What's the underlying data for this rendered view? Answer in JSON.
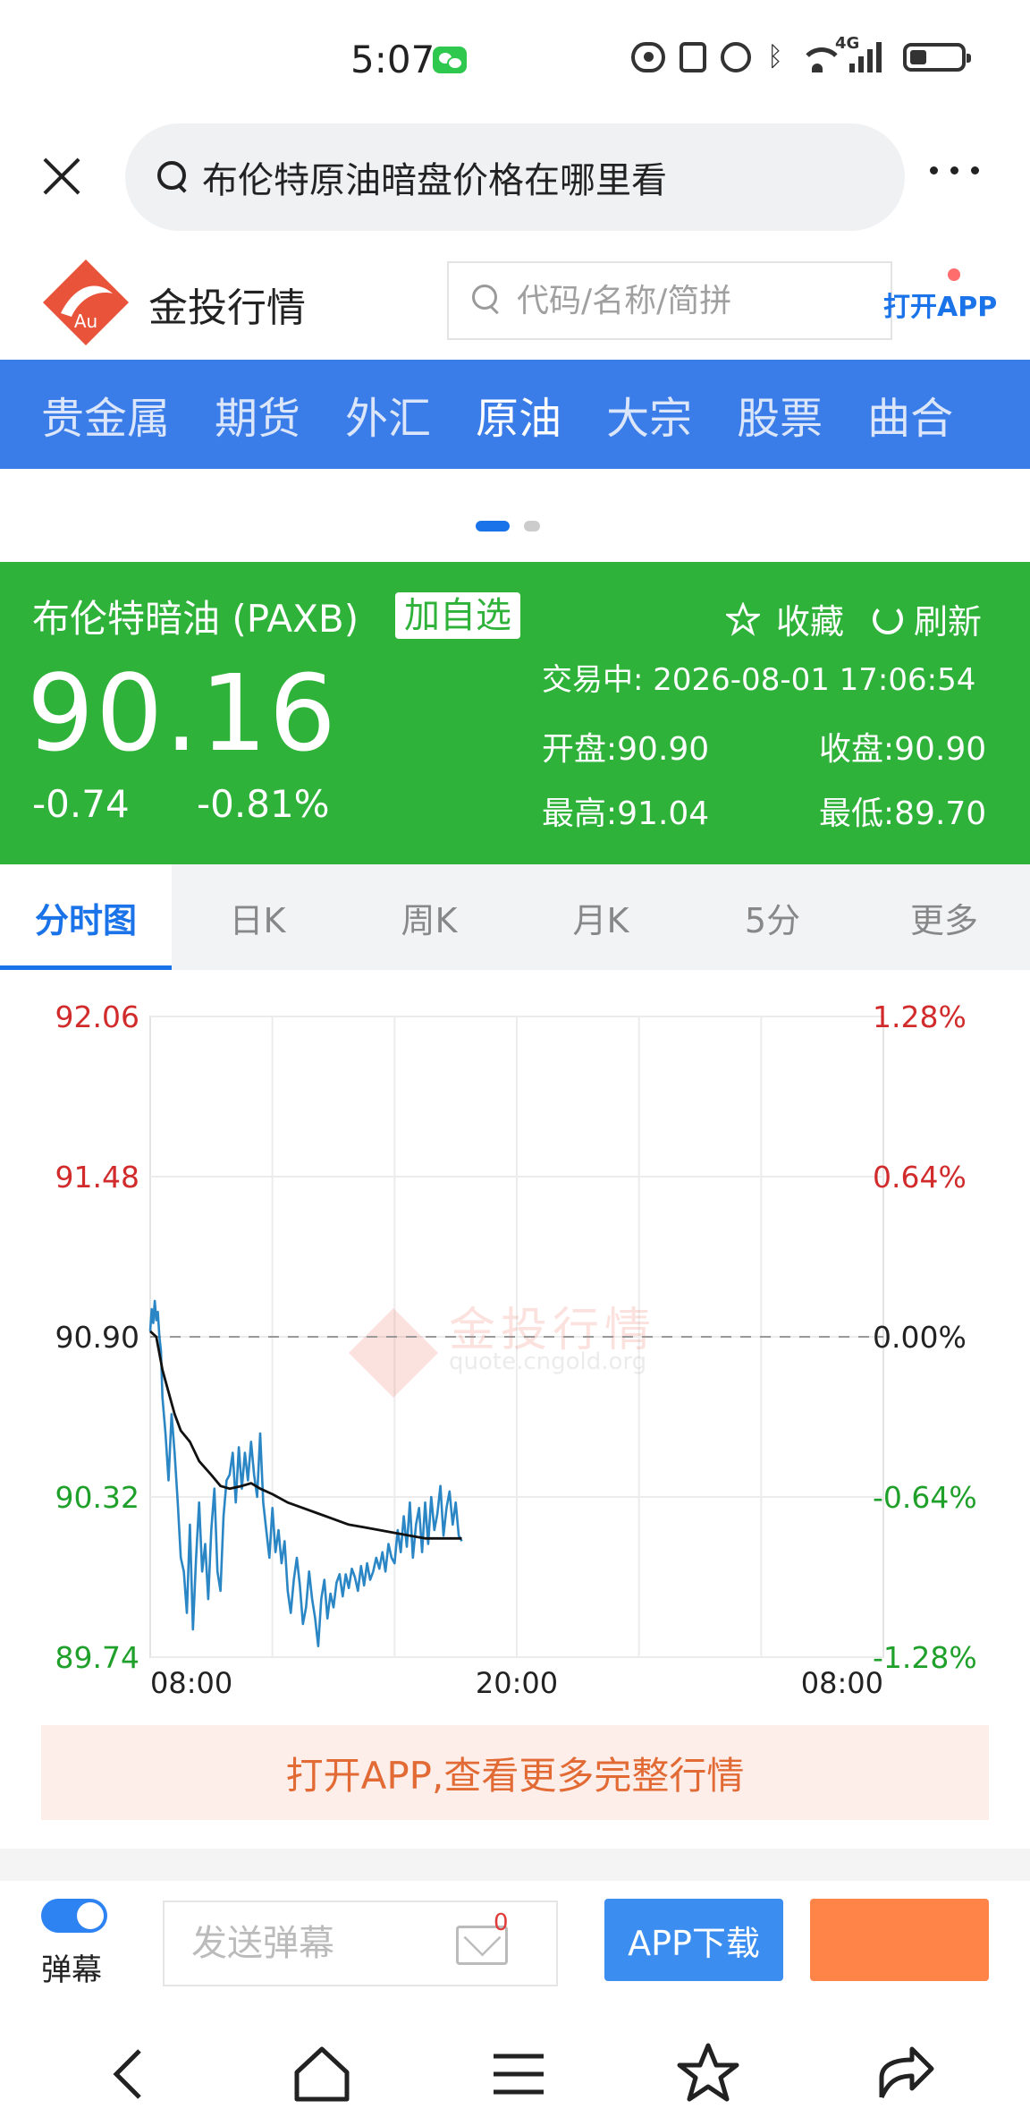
{
  "status_bar": {
    "time": "5:07",
    "network": "4G"
  },
  "browser": {
    "url_text": "布伦特原油暗盘价格在哪里看"
  },
  "site": {
    "logo_mark": "Au",
    "name": "金投行情",
    "search_placeholder": "代码/名称/简拼",
    "open_app": "打开APP"
  },
  "nav": {
    "items": [
      {
        "label": "贵金属"
      },
      {
        "label": "期货"
      },
      {
        "label": "外汇"
      },
      {
        "label": "原油"
      },
      {
        "label": "大宗"
      },
      {
        "label": "股票"
      },
      {
        "label": "曲合"
      }
    ],
    "active_index": 3
  },
  "quote": {
    "name": "布伦特暗油 (PAXB)",
    "add_favorite": "加自选",
    "collect": "收藏",
    "refresh": "刷新",
    "price": "90.16",
    "change": "-0.74",
    "change_pct": "-0.81%",
    "status": "交易中:  2026-08-01 17:06:54",
    "open": "开盘:90.90",
    "close": "收盘:90.90",
    "high": "最高:91.04",
    "low": "最低:89.70",
    "colors": {
      "panel": "#2fb23a",
      "up": "#d12b2b",
      "down": "#1fa02a"
    }
  },
  "chart_tabs": [
    {
      "label": "分时图"
    },
    {
      "label": "日K"
    },
    {
      "label": "周K"
    },
    {
      "label": "月K"
    },
    {
      "label": "5分"
    },
    {
      "label": "更多"
    }
  ],
  "chart_data": {
    "type": "line",
    "reference": 90.9,
    "ylim": [
      89.74,
      92.06
    ],
    "y_ticks_left": [
      "92.06",
      "91.48",
      "90.90",
      "90.32",
      "89.74"
    ],
    "y_ticks_right": [
      "1.28%",
      "0.64%",
      "0.00%",
      "-0.64%",
      "-1.28%"
    ],
    "x_ticks": [
      "08:00",
      "20:00",
      "08:00"
    ],
    "x_range_hours": [
      0,
      24
    ],
    "watermark": {
      "name": "金投行情",
      "url": "quote.cngold.org"
    },
    "series": [
      {
        "color": "#2a86c4",
        "x": [
          0.0,
          0.05,
          0.1,
          0.15,
          0.2,
          0.25,
          0.3,
          0.35,
          0.4,
          0.5,
          0.6,
          0.7,
          0.8,
          0.9,
          1.0,
          1.1,
          1.2,
          1.3,
          1.4,
          1.5,
          1.6,
          1.7,
          1.8,
          1.9,
          2.0,
          2.1,
          2.2,
          2.3,
          2.4,
          2.5,
          2.6,
          2.7,
          2.8,
          2.9,
          3.0,
          3.1,
          3.2,
          3.3,
          3.4,
          3.5,
          3.6,
          3.7,
          3.8,
          3.9,
          4.0,
          4.1,
          4.2,
          4.3,
          4.4,
          4.5,
          4.6,
          4.7,
          4.8,
          4.9,
          5.0,
          5.1,
          5.2,
          5.3,
          5.4,
          5.5,
          5.6,
          5.7,
          5.8,
          5.9,
          6.0,
          6.1,
          6.2,
          6.3,
          6.4,
          6.5,
          6.6,
          6.7,
          6.8,
          6.9,
          7.0,
          7.1,
          7.2,
          7.3,
          7.4,
          7.5,
          7.6,
          7.7,
          7.8,
          7.9,
          8.0,
          8.1,
          8.2,
          8.3,
          8.4,
          8.5,
          8.6,
          8.7,
          8.8,
          8.9,
          9.0,
          9.1,
          9.2,
          9.3,
          9.4,
          9.5,
          9.6,
          9.7,
          9.8,
          9.9,
          10.0,
          10.1,
          10.2
        ],
        "y": [
          90.92,
          91.0,
          90.95,
          91.03,
          90.96,
          90.99,
          90.9,
          90.85,
          90.68,
          90.55,
          90.38,
          90.62,
          90.48,
          90.3,
          90.1,
          90.05,
          89.9,
          90.22,
          89.84,
          90.1,
          90.3,
          90.05,
          90.15,
          89.95,
          90.2,
          90.35,
          90.05,
          89.98,
          90.25,
          90.38,
          90.4,
          90.48,
          90.3,
          90.5,
          90.35,
          90.48,
          90.38,
          90.52,
          90.4,
          90.32,
          90.55,
          90.3,
          90.2,
          90.1,
          90.28,
          90.12,
          90.2,
          90.08,
          90.16,
          89.98,
          89.9,
          90.02,
          90.1,
          90.0,
          89.86,
          89.92,
          90.05,
          89.95,
          89.88,
          89.78,
          89.95,
          90.02,
          89.88,
          89.97,
          89.92,
          90.01,
          90.04,
          89.96,
          90.04,
          89.99,
          90.06,
          90.03,
          89.98,
          90.07,
          90.0,
          90.08,
          90.02,
          90.05,
          90.1,
          90.06,
          90.12,
          90.05,
          90.15,
          90.1,
          90.08,
          90.2,
          90.12,
          90.25,
          90.14,
          90.3,
          90.1,
          90.22,
          90.28,
          90.12,
          90.3,
          90.15,
          90.32,
          90.2,
          90.26,
          90.36,
          90.18,
          90.28,
          90.34,
          90.22,
          90.3,
          90.18,
          90.16
        ]
      },
      {
        "color": "#111111",
        "x": [
          0.0,
          0.2,
          0.4,
          0.6,
          0.8,
          1.0,
          1.3,
          1.6,
          2.0,
          2.3,
          2.6,
          3.0,
          3.3,
          3.6,
          4.0,
          4.5,
          5.0,
          5.5,
          6.0,
          6.5,
          7.0,
          7.5,
          8.0,
          8.5,
          9.0,
          9.5,
          10.2
        ],
        "y": [
          90.92,
          90.9,
          90.78,
          90.7,
          90.62,
          90.56,
          90.52,
          90.45,
          90.4,
          90.36,
          90.35,
          90.36,
          90.37,
          90.35,
          90.33,
          90.3,
          90.28,
          90.26,
          90.24,
          90.22,
          90.21,
          90.2,
          90.19,
          90.18,
          90.17,
          90.17,
          90.17
        ]
      }
    ]
  },
  "open_app_banner": "打开APP,查看更多完整行情",
  "toolbar": {
    "danmu_label": "弹幕",
    "danmu_placeholder": "发送弹幕",
    "message_count": "0",
    "app_download": "APP下载"
  }
}
